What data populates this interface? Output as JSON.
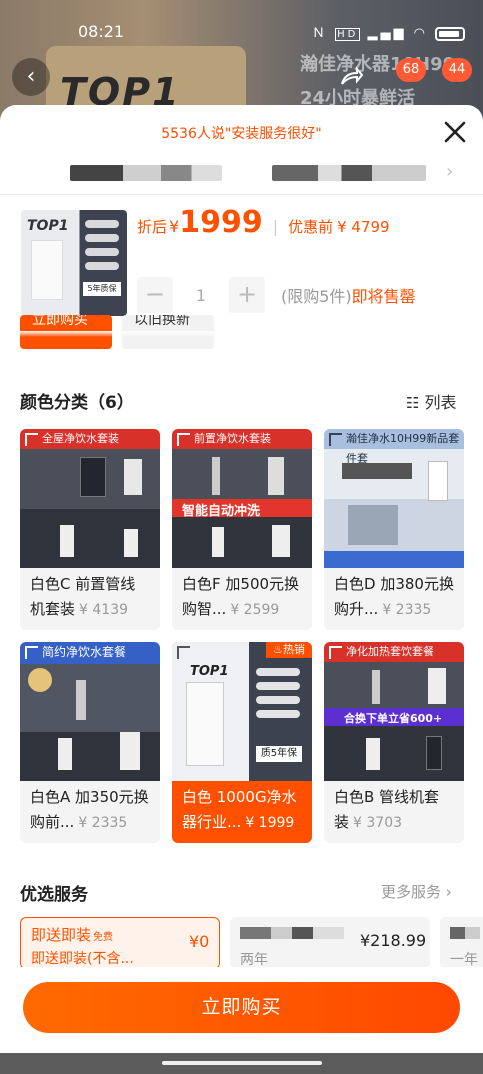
{
  "status_bar": {
    "time": "08:21",
    "icons_text": "N HD ⁴⁶ıll 𝄄"
  },
  "backdrop": {
    "title_line1": "瀚佳净水器10H99",
    "title_line2": "24小时暴鲜活",
    "banner_text": "TOP1",
    "cart_count": "68",
    "msg_count": "44"
  },
  "header": {
    "praise_text": "5536人说\"安装服务很好\""
  },
  "product": {
    "thumb_label": "TOP1",
    "thumb_badge": "5年质保",
    "after_label": "折后",
    "currency": "¥",
    "price": "1999",
    "before_label": "优惠前",
    "before_price": "¥ 4799",
    "quantity": "1",
    "minus": "−",
    "plus": "+",
    "limit_text": "(限购5件)",
    "soon_text": "即将售罄"
  },
  "peek_buttons": {
    "buy_now": "立即购买",
    "trade_in": "以旧换新"
  },
  "color_section": {
    "title": "颜色分类（6）",
    "list_label": "列表"
  },
  "variants": [
    {
      "name": "白色C 前置管线机套装",
      "price": "¥ 4139",
      "ribbon": "全屋净饮水套装",
      "selected": false
    },
    {
      "name": "白色F 加500元换购智...",
      "price": "¥ 2599",
      "ribbon": "前置净饮水套装",
      "banner": "智能自动冲洗",
      "selected": false
    },
    {
      "name": "白色D 加380元换购升...",
      "price": "¥ 2335",
      "ribbon": "瀚佳净水10H99新品套件套",
      "selected": false
    },
    {
      "name": "白色A 加350元换购前...",
      "price": "¥ 2335",
      "ribbon": "简约净饮水套餐",
      "selected": false
    },
    {
      "name": "白色 1000G净水器行业...",
      "price": "¥ 1999",
      "ribbon": "热销",
      "label": "TOP1",
      "badge": "质5年保",
      "selected": true
    },
    {
      "name": "白色B 管线机套装",
      "price": "¥ 3703",
      "ribbon": "净化加热套饮套餐",
      "banner": "合换下单立省600+",
      "selected": false
    }
  ],
  "services": {
    "title": "优选服务",
    "more": "更多服务",
    "items": [
      {
        "title": "即送即装",
        "tag": "免费",
        "desc": "即送即装(不含...",
        "price": "¥0",
        "selected": true
      },
      {
        "title": "",
        "desc": "两年",
        "price": "¥218.99",
        "selected": false
      },
      {
        "title": "",
        "desc": "一年",
        "price": "",
        "selected": false
      }
    ]
  },
  "footer": {
    "buy_label": "立即购买"
  },
  "colors": {
    "accent": "#ff5000",
    "accent_dark": "#ff4800",
    "card_bg": "#f4f4f4"
  }
}
